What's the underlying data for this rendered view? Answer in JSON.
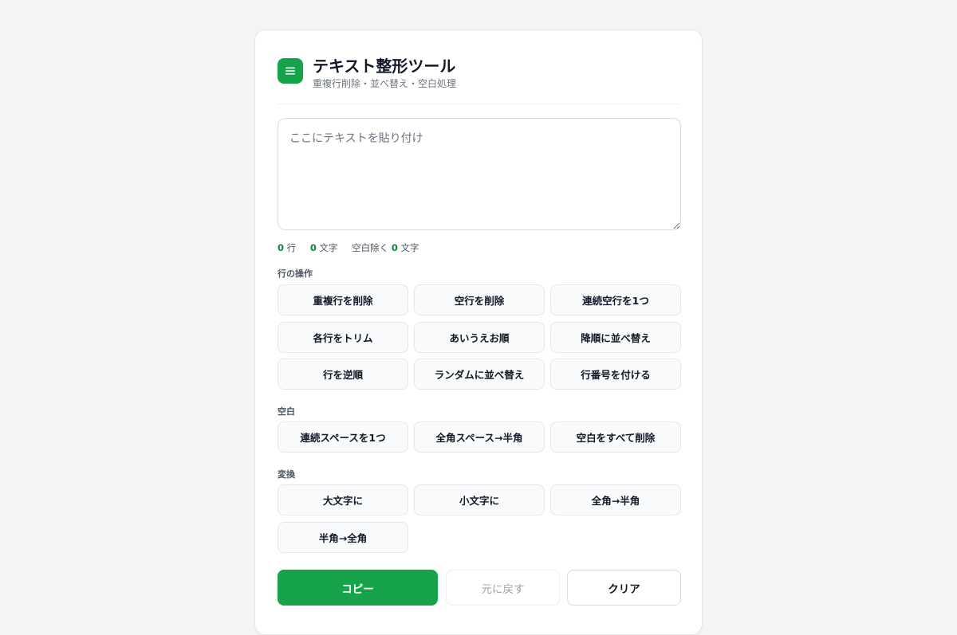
{
  "app": {
    "title": "テキスト整形ツール",
    "subtitle": "重複行削除・並べ替え・空白処理",
    "logo_icon": "menu-lines-icon",
    "accent_color": "#16a34a"
  },
  "input": {
    "placeholder": "ここにテキストを貼り付け",
    "value": ""
  },
  "stats": {
    "lines_count": "0",
    "lines_label": "行",
    "chars_count": "0",
    "chars_label": "文字",
    "nospace_prefix": "空白除く",
    "nospace_count": "0",
    "nospace_label": "文字"
  },
  "sections": {
    "lines": {
      "label": "行の操作",
      "buttons": [
        "重複行を削除",
        "空行を削除",
        "連続空行を1つ",
        "各行をトリム",
        "あいうえお順",
        "降順に並べ替え",
        "行を逆順",
        "ランダムに並べ替え",
        "行番号を付ける"
      ]
    },
    "whitespace": {
      "label": "空白",
      "buttons": [
        "連続スペースを1つ",
        "全角スペース→半角",
        "空白をすべて削除"
      ]
    },
    "convert": {
      "label": "変換",
      "buttons": [
        "大文字に",
        "小文字に",
        "全角→半角",
        "半角→全角"
      ]
    }
  },
  "actions": {
    "copy": "コピー",
    "undo": "元に戻す",
    "clear": "クリア"
  }
}
